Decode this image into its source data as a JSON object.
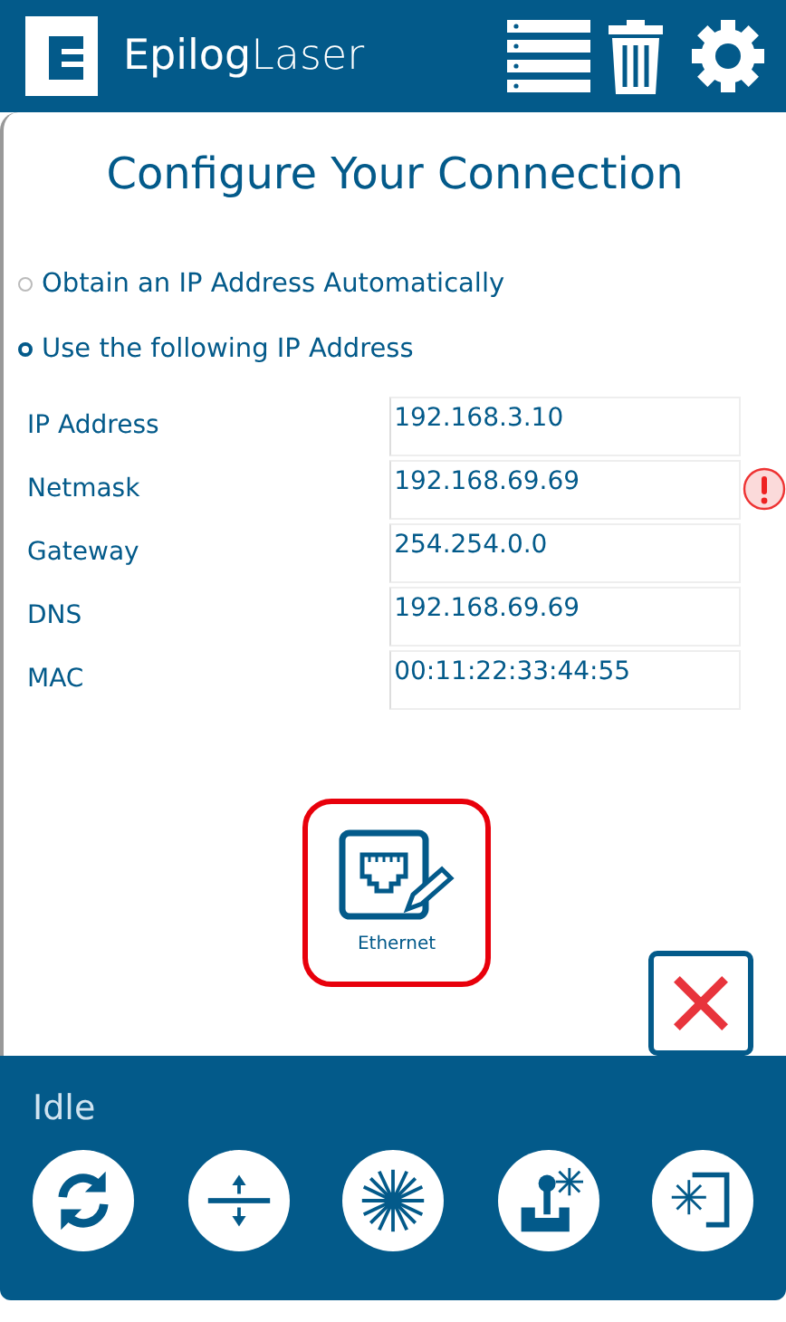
{
  "header": {
    "logo": "**Epilog**Laser"
  },
  "title": "Configure Your Connection",
  "options": [
    {
      "label": "Obtain an IP Address Automatically",
      "selected": false
    },
    {
      "label": "Use the following IP Address",
      "selected": true
    }
  ],
  "fields": [
    {
      "label": "IP Address",
      "value": "192.168.3.10",
      "warning": false
    },
    {
      "label": "Netmask",
      "value": "192.168.69.69",
      "warning": true
    },
    {
      "label": "Gateway",
      "value": "254.254.0.0",
      "warning": false
    },
    {
      "label": "DNS",
      "value": "192.168.69.69",
      "warning": false
    },
    {
      "label": "MAC",
      "value": "00:11:22:33:44:55",
      "warning": false
    }
  ],
  "connection": {
    "label": "Ethernet",
    "selected": true
  },
  "status": "Idle",
  "tools": [
    {
      "kind": "refresh"
    },
    {
      "kind": "focus"
    },
    {
      "kind": "laser"
    },
    {
      "kind": "jog"
    },
    {
      "kind": "frame"
    }
  ]
}
